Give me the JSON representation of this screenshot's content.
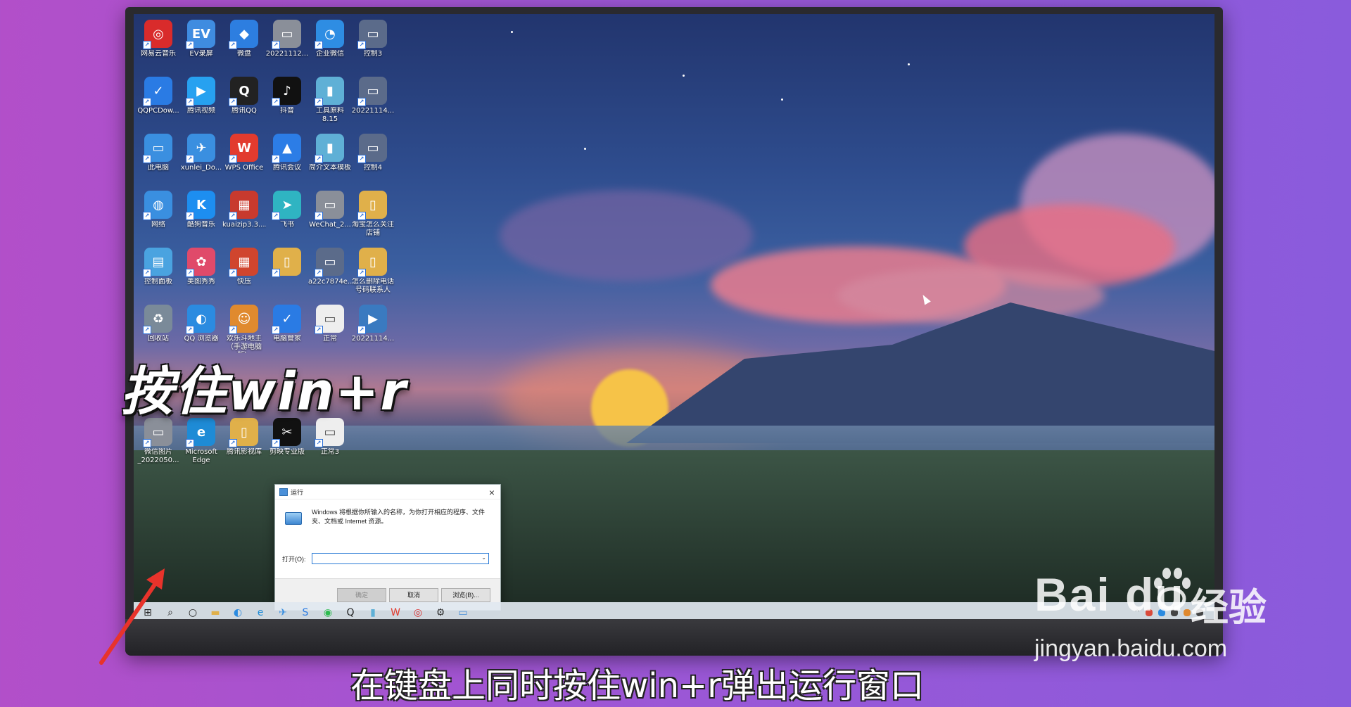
{
  "desktop": {
    "icons": [
      {
        "label": "网易云音乐",
        "color": "#d92b2b",
        "glyph": "◎"
      },
      {
        "label": "EV录屏",
        "color": "#3f8ce0",
        "glyph": "EV"
      },
      {
        "label": "微盘",
        "color": "#2d7ee0",
        "glyph": "◆"
      },
      {
        "label": "20221112...",
        "color": "#8a8f99",
        "glyph": "▭"
      },
      {
        "label": "企业微信",
        "color": "#2e8de3",
        "glyph": "◔"
      },
      {
        "label": "控制3",
        "color": "#5b6b8a",
        "glyph": "▭"
      },
      {
        "label": "QQPCDow...",
        "color": "#2a7be4",
        "glyph": "✓"
      },
      {
        "label": "腾讯视频",
        "color": "#27a1f0",
        "glyph": "▶"
      },
      {
        "label": "腾讯QQ",
        "color": "#222222",
        "glyph": "Q"
      },
      {
        "label": "抖音",
        "color": "#111111",
        "glyph": "♪"
      },
      {
        "label": "工具原料8.15",
        "color": "#5fb0d6",
        "glyph": "▮"
      },
      {
        "label": "20221114...",
        "color": "#5b6b8a",
        "glyph": "▭"
      },
      {
        "label": "此电脑",
        "color": "#3a8fe0",
        "glyph": "▭"
      },
      {
        "label": "xunlei_Do...",
        "color": "#3a8fe0",
        "glyph": "✈"
      },
      {
        "label": "WPS Office",
        "color": "#e23b2e",
        "glyph": "W"
      },
      {
        "label": "腾讯会议",
        "color": "#2c7de6",
        "glyph": "▲"
      },
      {
        "label": "简介文本模板",
        "color": "#5fb0d6",
        "glyph": "▮"
      },
      {
        "label": "控制4",
        "color": "#5b6b8a",
        "glyph": "▭"
      },
      {
        "label": "网络",
        "color": "#3a8fe0",
        "glyph": "◍"
      },
      {
        "label": "酷狗音乐",
        "color": "#1d8ef0",
        "glyph": "K"
      },
      {
        "label": "kuaizip3.3....",
        "color": "#c83a2e",
        "glyph": "▦"
      },
      {
        "label": "飞书",
        "color": "#2fb4c2",
        "glyph": "➤"
      },
      {
        "label": "WeChat_2...",
        "color": "#8a8f99",
        "glyph": "▭"
      },
      {
        "label": "淘宝怎么关注店铺",
        "color": "#e0b04a",
        "glyph": "▯"
      },
      {
        "label": "控制面板",
        "color": "#4aa3e0",
        "glyph": "▤"
      },
      {
        "label": "美图秀秀",
        "color": "#e04a6a",
        "glyph": "✿"
      },
      {
        "label": "快压",
        "color": "#d0452e",
        "glyph": "▦"
      },
      {
        "label": "",
        "color": "#e0b04a",
        "glyph": "▯"
      },
      {
        "label": "a22c7874e...",
        "color": "#5b6b8a",
        "glyph": "▭"
      },
      {
        "label": "怎么删除电话号码联系人",
        "color": "#e0b04a",
        "glyph": "▯"
      },
      {
        "label": "回收站",
        "color": "#7a8a99",
        "glyph": "♻"
      },
      {
        "label": "QQ 浏览器",
        "color": "#2b8be0",
        "glyph": "◐"
      },
      {
        "label": "欢乐斗地主（手游电脑版）",
        "color": "#e08a2e",
        "glyph": "☺"
      },
      {
        "label": "电脑管家",
        "color": "#2a7be4",
        "glyph": "✓"
      },
      {
        "label": "正常",
        "color": "#eeeeee",
        "glyph": "▭"
      },
      {
        "label": "20221114...",
        "color": "#3a7ac0",
        "glyph": "▶"
      },
      {
        "label": "微信图片_2022050...",
        "color": "#8a8f99",
        "glyph": "▭"
      },
      {
        "label": "Microsoft Edge",
        "color": "#1e8bd6",
        "glyph": "e"
      },
      {
        "label": "腾讯影视库",
        "color": "#e0b04a",
        "glyph": "▯"
      },
      {
        "label": "剪映专业版",
        "color": "#111111",
        "glyph": "✂"
      },
      {
        "label": "正常3",
        "color": "#eeeeee",
        "glyph": "▭"
      }
    ]
  },
  "run_dialog": {
    "title": "运行",
    "close": "×",
    "description": "Windows 将根据你所输入的名称，为你打开相应的程序、文件夹、文档或 Internet 资源。",
    "open_label": "打开(O):",
    "input_value": "",
    "ok_label": "确定",
    "cancel_label": "取消",
    "browse_label": "浏览(B)..."
  },
  "taskbar": {
    "items": [
      {
        "name": "start-icon",
        "glyph": "⊞",
        "color": "#222222"
      },
      {
        "name": "search-icon",
        "glyph": "⌕",
        "color": "#222222"
      },
      {
        "name": "task-view-icon",
        "glyph": "○",
        "color": "#222222"
      },
      {
        "name": "file-explorer-icon",
        "glyph": "▬",
        "color": "#e0b04a"
      },
      {
        "name": "qq-browser-icon",
        "glyph": "◐",
        "color": "#2b8be0"
      },
      {
        "name": "edge-icon",
        "glyph": "e",
        "color": "#1e8bd6"
      },
      {
        "name": "xunlei-icon",
        "glyph": "✈",
        "color": "#3a8fe0"
      },
      {
        "name": "sogou-icon",
        "glyph": "S",
        "color": "#2a7be4"
      },
      {
        "name": "wechat-icon",
        "glyph": "◉",
        "color": "#2dbb4e"
      },
      {
        "name": "qq-icon",
        "glyph": "Q",
        "color": "#222222"
      },
      {
        "name": "notes-icon",
        "glyph": "▮",
        "color": "#5fb0d6"
      },
      {
        "name": "wps-icon",
        "glyph": "W",
        "color": "#e23b2e"
      },
      {
        "name": "netease-music-icon",
        "glyph": "◎",
        "color": "#d92b2b"
      },
      {
        "name": "settings-icon",
        "glyph": "⚙",
        "color": "#333333"
      },
      {
        "name": "run-window-icon",
        "glyph": "▭",
        "color": "#4a90d9"
      }
    ],
    "tray_chevron": "^"
  },
  "overlay": {
    "caption_top": "按住win+r",
    "caption_bottom": "在键盘上同时按住win+r弹出运行窗口",
    "watermark_logo": "Bai du",
    "watermark_cn": "经验",
    "watermark_url": "jingyan.baidu.com"
  }
}
